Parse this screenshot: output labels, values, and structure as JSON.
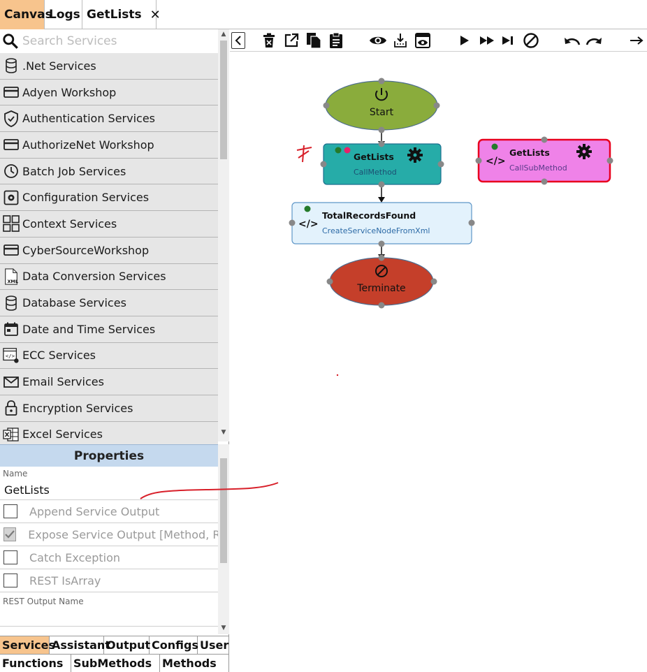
{
  "tabs": {
    "canvas": "Canvas",
    "logs": "Logs",
    "getlists": "GetLists",
    "close": "✕"
  },
  "search": {
    "placeholder": "Search Services"
  },
  "services": [
    ".Net Services",
    "Adyen Workshop",
    "Authentication Services",
    "AuthorizeNet Workshop",
    "Batch Job Services",
    "Configuration Services",
    "Context Services",
    "CyberSourceWorkshop",
    "Data Conversion Services",
    "Database Services",
    "Date and Time Services",
    "ECC Services",
    "Email Services",
    "Encryption Services",
    "Excel Services"
  ],
  "properties": {
    "title": "Properties",
    "name_label": "Name",
    "name_value": "GetLists",
    "options": [
      {
        "label": "Append Service Output",
        "checked": false
      },
      {
        "label": "Expose Service Output [Method, RE...",
        "checked": true
      },
      {
        "label": "Catch Exception",
        "checked": false
      },
      {
        "label": "REST IsArray",
        "checked": false
      }
    ],
    "rest_output_label": "REST Output Name"
  },
  "bottom_tabs": {
    "row1": [
      "Services",
      "Assistant",
      "Output",
      "Configs",
      "User"
    ],
    "row2": [
      "Functions",
      "SubMethods",
      "Methods"
    ]
  },
  "nodes": {
    "start": {
      "label": "Start"
    },
    "getlists": {
      "title": "GetLists",
      "subtitle": "CallMethod"
    },
    "getlists_sub": {
      "title": "GetLists",
      "subtitle": "CallSubMethod"
    },
    "total": {
      "title": "TotalRecordsFound",
      "subtitle": "CreateServiceNodeFromXml"
    },
    "terminate": {
      "label": "Terminate"
    }
  },
  "colors": {
    "accent_tab": "#f7c48d",
    "start_fill": "#8aac3c",
    "callmethod_fill": "#26aca8",
    "callsub_fill": "#ef82e8",
    "callsub_border": "#e8001e",
    "xml_fill": "#e3f2fc",
    "terminate_fill": "#c53f2a"
  }
}
